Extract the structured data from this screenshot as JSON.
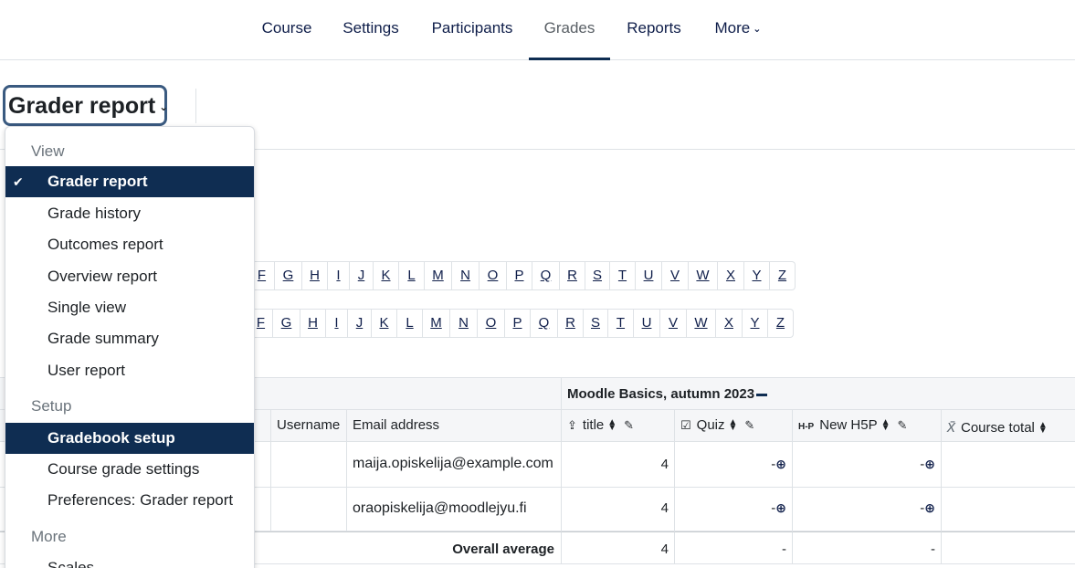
{
  "nav": {
    "tabs": [
      {
        "label": "Course"
      },
      {
        "label": "Settings"
      },
      {
        "label": "Participants"
      },
      {
        "label": "Grades"
      },
      {
        "label": "Reports"
      },
      {
        "label": "More"
      }
    ],
    "active": "Grades"
  },
  "selector": {
    "label": "Grader report"
  },
  "initials_first": [
    "F",
    "G",
    "H",
    "I",
    "J",
    "K",
    "L",
    "M",
    "N",
    "O",
    "P",
    "Q",
    "R",
    "S",
    "T",
    "U",
    "V",
    "W",
    "X",
    "Y",
    "Z"
  ],
  "initials_last": [
    "F",
    "G",
    "H",
    "I",
    "J",
    "K",
    "L",
    "M",
    "N",
    "O",
    "P",
    "Q",
    "R",
    "S",
    "T",
    "U",
    "V",
    "W",
    "X",
    "Y",
    "Z"
  ],
  "table": {
    "category": "Moodle Basics, autumn 2023",
    "headers": {
      "username": "Username",
      "email": "Email address",
      "title": "title",
      "quiz": "Quiz",
      "h5p": "New H5P",
      "total": "Course total",
      "h5p_icon_text": "H-P"
    },
    "rows": [
      {
        "email": "maija.opiskelija@example.com",
        "title": "4",
        "quiz": "-",
        "h5p": "-"
      },
      {
        "email": "oraopiskelija@moodlejyu.fi",
        "title": "4",
        "quiz": "-",
        "h5p": "-"
      }
    ],
    "overall": {
      "label": "Overall average",
      "title": "4",
      "quiz": "-",
      "h5p": "-"
    }
  },
  "dropdown": {
    "sections": [
      {
        "heading": "View",
        "items": [
          {
            "label": "Grader report",
            "selected": true
          },
          {
            "label": "Grade history"
          },
          {
            "label": "Outcomes report"
          },
          {
            "label": "Overview report"
          },
          {
            "label": "Single view"
          },
          {
            "label": "Grade summary"
          },
          {
            "label": "User report"
          }
        ]
      },
      {
        "heading": "Setup",
        "items": [
          {
            "label": "Gradebook setup",
            "highlighted": true
          },
          {
            "label": "Course grade settings"
          },
          {
            "label": "Preferences: Grader report"
          }
        ]
      },
      {
        "heading": "More",
        "items": [
          {
            "label": "Scales"
          }
        ]
      }
    ]
  },
  "colors": {
    "brand": "#0f2d52",
    "link": "#0f1e4a"
  }
}
